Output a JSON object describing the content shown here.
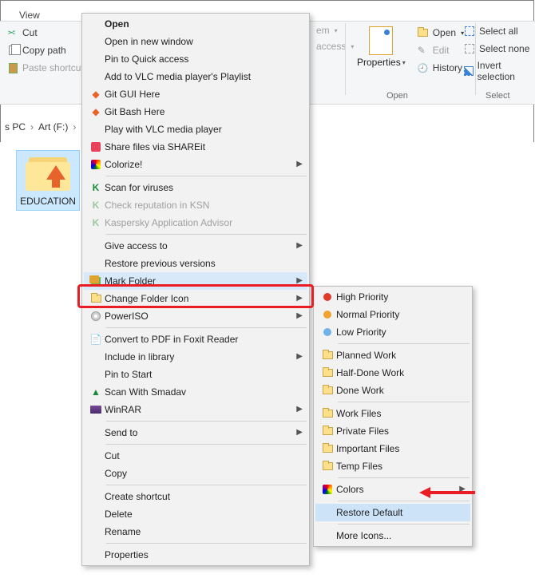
{
  "ribbon": {
    "tab": "View",
    "clipboard": {
      "cut": "Cut",
      "copy_path": "Copy path",
      "paste_shortcut": "Paste shortcut"
    },
    "partial": {
      "em": "em",
      "access": "access"
    },
    "open_group": {
      "properties": "Properties",
      "open": "Open",
      "edit": "Edit",
      "history": "History",
      "label": "Open"
    },
    "select_group": {
      "select_all": "Select all",
      "select_none": "Select none",
      "invert": "Invert selection",
      "label": "Select"
    }
  },
  "breadcrumb": {
    "a": "s PC",
    "b": "Art (F:)"
  },
  "folder": {
    "name": "EDUCATION"
  },
  "menu": {
    "open": "Open",
    "open_new_window": "Open in new window",
    "pin_quick": "Pin to Quick access",
    "add_vlc": "Add to VLC media player's Playlist",
    "git_gui": "Git GUI Here",
    "git_bash": "Git Bash Here",
    "play_vlc": "Play with VLC media player",
    "shareit": "Share files via SHAREit",
    "colorize": "Colorize!",
    "scan_virus": "Scan for viruses",
    "ksn": "Check reputation in KSN",
    "kas_advisor": "Kaspersky Application Advisor",
    "give_access": "Give access to",
    "restore_prev": "Restore previous versions",
    "mark_folder": "Mark Folder",
    "change_icon": "Change Folder Icon",
    "poweriso": "PowerISO",
    "convert_pdf": "Convert to PDF in Foxit Reader",
    "include_lib": "Include in library",
    "pin_start": "Pin to Start",
    "scan_smadav": "Scan With Smadav",
    "winrar": "WinRAR",
    "send_to": "Send to",
    "cut": "Cut",
    "copy": "Copy",
    "create_shortcut": "Create shortcut",
    "delete": "Delete",
    "rename": "Rename",
    "properties": "Properties"
  },
  "submenu": {
    "high": "High Priority",
    "normal": "Normal Priority",
    "low": "Low Priority",
    "planned": "Planned Work",
    "half": "Half-Done Work",
    "done": "Done Work",
    "work_files": "Work Files",
    "private": "Private Files",
    "important": "Important Files",
    "temp": "Temp Files",
    "colors": "Colors",
    "restore": "Restore Default",
    "more": "More Icons..."
  },
  "colors": {
    "high": "#e13b2b",
    "normal": "#f0a330",
    "low": "#6fb2e8",
    "planned": "#f5c948",
    "half": "#f5c948",
    "done": "#7ac060",
    "work": "#f0c96a",
    "private": "#b7b7b7",
    "important": "#f6c243",
    "temp": "#f6c243"
  }
}
